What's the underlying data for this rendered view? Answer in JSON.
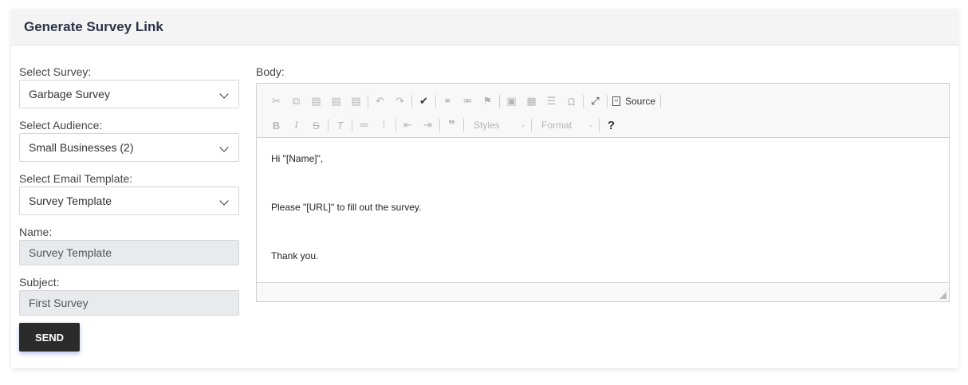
{
  "header": {
    "title": "Generate Survey Link"
  },
  "form": {
    "survey_label": "Select Survey:",
    "survey_value": "Garbage Survey",
    "audience_label": "Select Audience:",
    "audience_value": "Small Businesses (2)",
    "template_label": "Select Email Template:",
    "template_value": "Survey Template",
    "name_label": "Name:",
    "name_value": "Survey Template",
    "subject_label": "Subject:",
    "subject_value": "First Survey",
    "send_label": "SEND"
  },
  "editor": {
    "body_label": "Body:",
    "source_label": "Source",
    "styles_label": "Styles",
    "format_label": "Format",
    "help_label": "?",
    "paragraphs": [
      "Hi \"[Name]\",",
      "Please \"[URL]\" to fill out the survey.",
      "Thank you."
    ]
  }
}
